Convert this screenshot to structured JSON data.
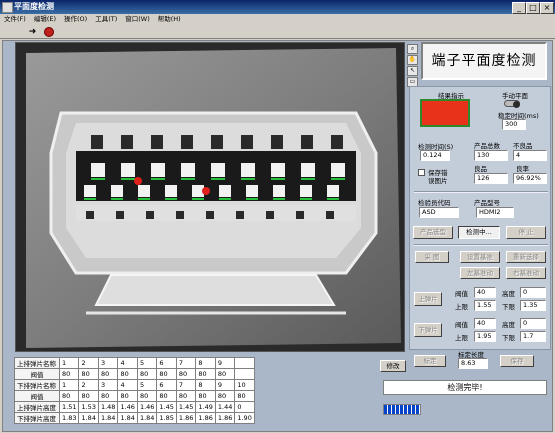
{
  "window": {
    "title": "平面度检测"
  },
  "menu": [
    "文件(F)",
    "编辑(E)",
    "操作(O)",
    "工具(T)",
    "窗口(W)",
    "帮助(H)"
  ],
  "app_title": "端子平面度检测",
  "result": {
    "label": "结果指示",
    "color": "#e8321a"
  },
  "manual": {
    "toggle_label": "手动平面",
    "delay_label": "稳定时间(ms)",
    "delay_value": "300"
  },
  "timing": {
    "label": "检测时间(S)",
    "value": "0.124"
  },
  "counts": {
    "total_label": "产品总数",
    "total_value": "130",
    "bad_label": "不良品",
    "bad_value": "4",
    "good_label": "良品",
    "good_value": "126",
    "rate_label": "良率",
    "rate_value": "96.92%"
  },
  "save_bad": {
    "label_1": "保存错",
    "label_2": "误图片"
  },
  "inspector": {
    "label": "检验员代码",
    "value": "ASD"
  },
  "product": {
    "label": "产品型号",
    "value": "HDMI2"
  },
  "buttons": {
    "select_product": "产品选型",
    "detecting": "检测中...",
    "stop": "停 止",
    "capture": "采 图",
    "set_baseline": "设置基准",
    "reselect": "重新选择",
    "left_move": "左基准动",
    "right_move": "右基准动",
    "upper": "上弹片",
    "lower": "下弹片",
    "calibrate": "标定",
    "save": "保存",
    "modify": "修改"
  },
  "upper_params": {
    "threshold_label": "阀值",
    "threshold": "40",
    "height_label": "高度",
    "height": "0",
    "upper_label": "上限",
    "upper": "1.55",
    "lower_label": "下限",
    "lower": "1.35"
  },
  "lower_params": {
    "threshold_label": "阀值",
    "threshold": "40",
    "height_label": "高度",
    "height": "0",
    "upper_label": "上限",
    "upper": "1.95",
    "lower_label": "下限",
    "lower": "1.7"
  },
  "calibration": {
    "label": "标定长度",
    "value": "8.63"
  },
  "status_text": "检测完毕!",
  "progress": 1.0,
  "table": {
    "rows": [
      {
        "header": "上排弹片名称",
        "cells": [
          "1",
          "2",
          "3",
          "4",
          "5",
          "6",
          "7",
          "8",
          "9",
          ""
        ]
      },
      {
        "header": "阀值",
        "cells": [
          "80",
          "80",
          "80",
          "80",
          "80",
          "80",
          "80",
          "80",
          "80",
          ""
        ]
      },
      {
        "header": "下排弹片名称",
        "cells": [
          "1",
          "2",
          "3",
          "4",
          "5",
          "6",
          "7",
          "8",
          "9",
          "10"
        ]
      },
      {
        "header": "阀值",
        "cells": [
          "80",
          "80",
          "80",
          "80",
          "80",
          "80",
          "80",
          "80",
          "80",
          "80"
        ]
      },
      {
        "header": "上排弹片高度",
        "cells": [
          "1.51",
          "1.53",
          "1.48",
          "1.46",
          "1.46",
          "1.45",
          "1.45",
          "1.49",
          "1.44",
          "0"
        ]
      },
      {
        "header": "下排弹片高度",
        "cells": [
          "1.83",
          "1.84",
          "1.84",
          "1.84",
          "1.84",
          "1.85",
          "1.86",
          "1.86",
          "1.86",
          "1.90"
        ]
      }
    ]
  }
}
